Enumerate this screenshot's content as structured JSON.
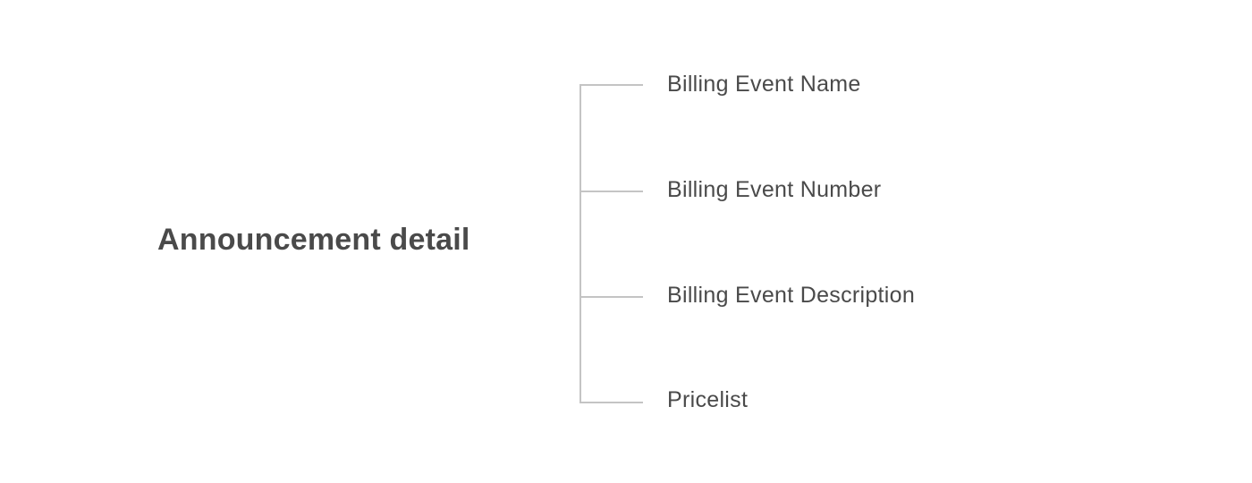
{
  "root": {
    "label": "Announcement detail"
  },
  "children": [
    {
      "label": "Billing Event Name"
    },
    {
      "label": "Billing Event Number"
    },
    {
      "label": "Billing Event Description"
    },
    {
      "label": "Pricelist"
    }
  ],
  "colors": {
    "text": "#4a4a4a",
    "connector": "#c4c4c4",
    "background": "#ffffff"
  }
}
